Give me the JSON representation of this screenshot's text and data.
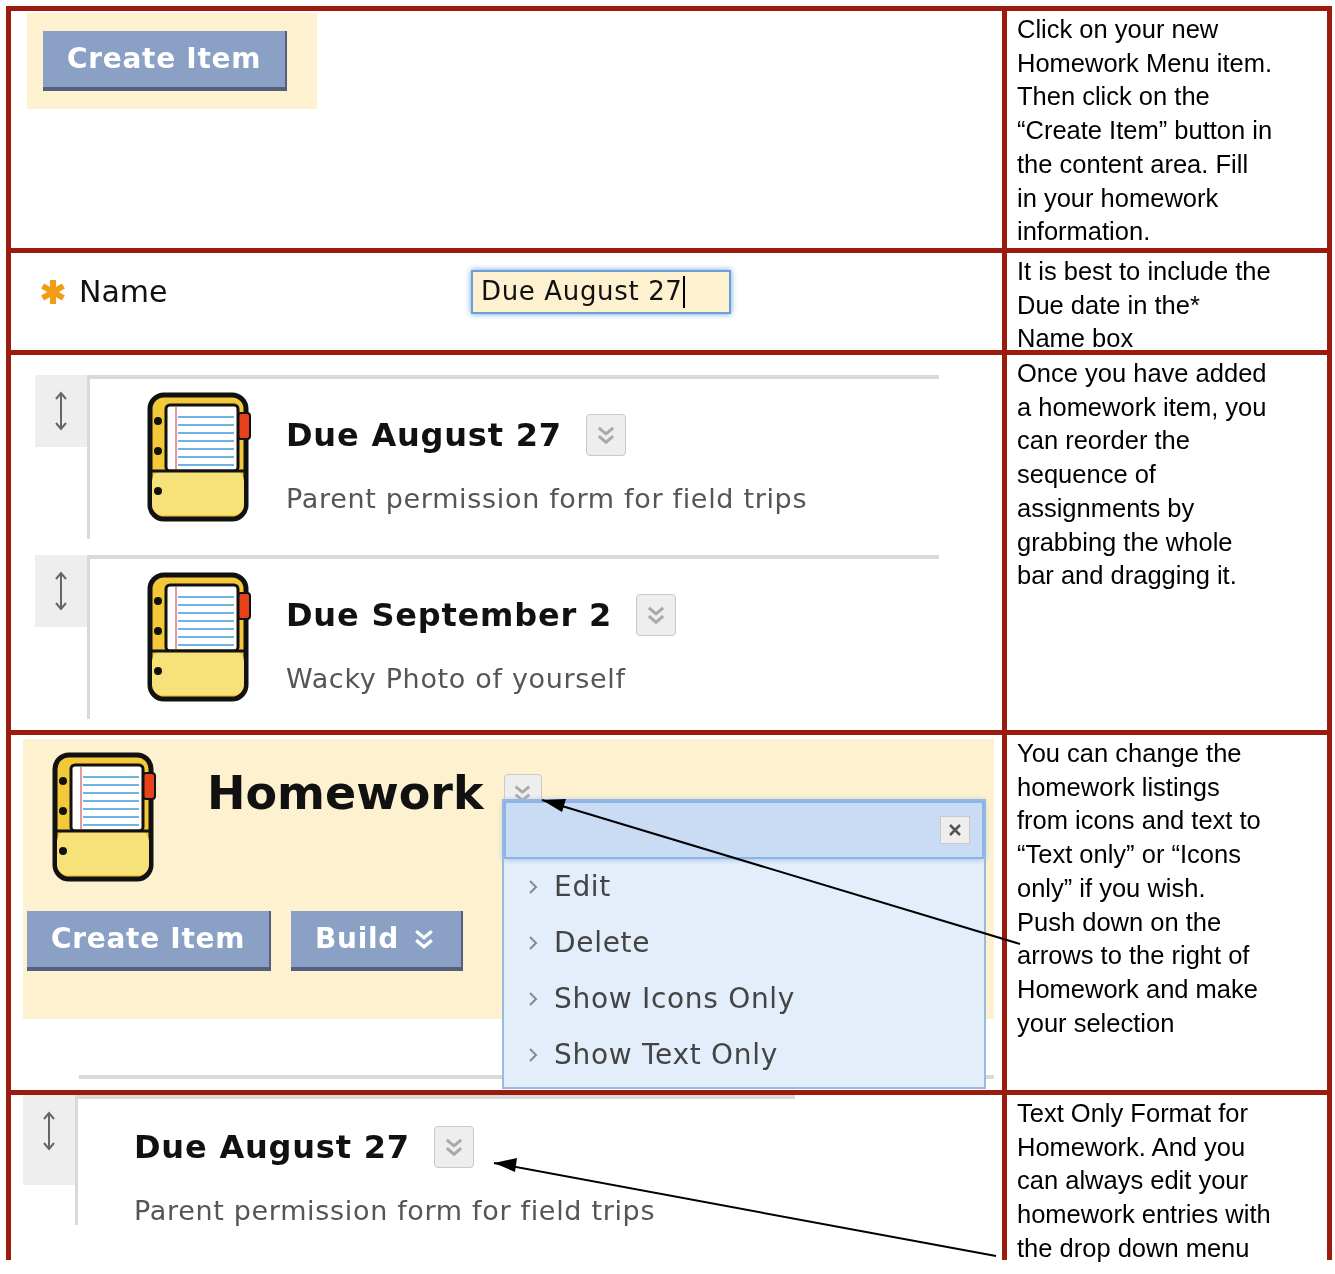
{
  "rows": [
    {
      "kind": "create",
      "button": "Create Item",
      "note": "Click on your new\nHomework Menu item.\nThen click on the\n“Create Item” button in\nthe content area. Fill\nin your homework\ninformation."
    },
    {
      "kind": "name",
      "label": "Name",
      "value": "Due August 27",
      "note": "It is best to include the\nDue date in the*\nName box"
    },
    {
      "kind": "items",
      "items": [
        {
          "title": "Due August 27",
          "description": "Parent permission form for field trips"
        },
        {
          "title": "Due September 2",
          "description": "Wacky Photo of yourself"
        }
      ],
      "note": "Once you have added\na homework item, you\ncan reorder the\nsequence of\nassignments by\ngrabbing the whole\nbar and dragging it."
    },
    {
      "kind": "menu",
      "title": "Homework",
      "buttons": [
        {
          "label": "Create Item",
          "dropdown": false
        },
        {
          "label": "Build",
          "dropdown": true
        }
      ],
      "menu": [
        "Edit",
        "Delete",
        "Show Icons Only",
        "Show Text Only"
      ],
      "note": "You can change the\nhomework listings\nfrom icons and text to\n“Text only” or “Icons\nonly”  if you wish.\nPush down on the\narrows to the right of\nHomework and make\nyour selection"
    },
    {
      "kind": "textonly",
      "title": "Due August 27",
      "description": "Parent permission form for field trips",
      "note": "Text Only Format for\nHomework. And you\ncan always edit your\nhomework entries with\nthe drop down menu"
    }
  ]
}
